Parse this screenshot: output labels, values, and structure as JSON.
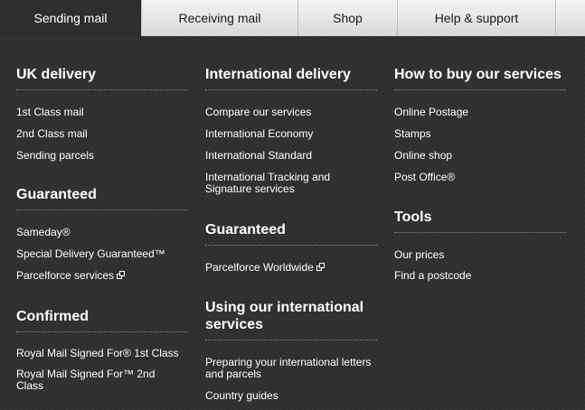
{
  "tabs": [
    {
      "label": "Sending mail"
    },
    {
      "label": "Receiving mail"
    },
    {
      "label": "Shop"
    },
    {
      "label": "Help & support"
    }
  ],
  "columns": [
    {
      "sections": [
        {
          "heading": "UK delivery",
          "links": [
            "1st Class mail",
            "2nd Class mail",
            "Sending parcels"
          ]
        },
        {
          "heading": "Guaranteed",
          "links": [
            "Sameday®",
            "Special Delivery Guaranteed™",
            "Parcelforce services"
          ]
        },
        {
          "heading": "Confirmed",
          "links": [
            "Royal Mail Signed For® 1st Class",
            "Royal Mail Signed For™ 2nd Class"
          ]
        }
      ]
    },
    {
      "sections": [
        {
          "heading": "International delivery",
          "links": [
            "Compare our services",
            "International Economy",
            "International Standard",
            "International Tracking and Signature services"
          ]
        },
        {
          "heading": "Guaranteed",
          "links": [
            "Parcelforce Worldwide"
          ]
        },
        {
          "heading": "Using our international services",
          "links": [
            "Preparing your international letters and parcels",
            "Country guides"
          ]
        }
      ]
    },
    {
      "sections": [
        {
          "heading": "How to buy our services",
          "links": [
            "Online Postage",
            "Stamps",
            "Online shop",
            "Post Office®"
          ]
        },
        {
          "heading": "Tools",
          "links": [
            "Our prices",
            "Find a postcode"
          ]
        }
      ]
    }
  ]
}
